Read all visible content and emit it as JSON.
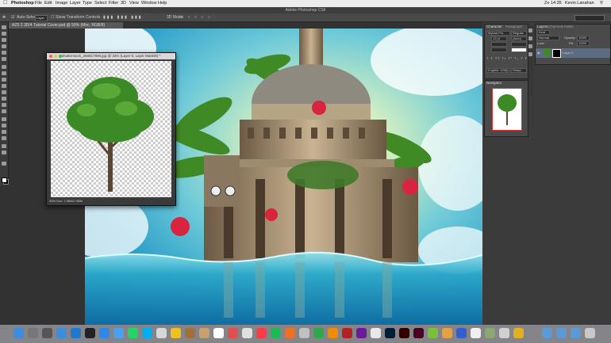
{
  "menubar": {
    "items": [
      "Photoshop",
      "File",
      "Edit",
      "Image",
      "Layer",
      "Type",
      "Select",
      "Filter",
      "3D",
      "View",
      "Window",
      "Help"
    ],
    "clock": "Zo 14:35",
    "user": "Kevin Lanahan"
  },
  "app_title": "Adobe Photoshop CS6",
  "options": {
    "auto_select": "Auto-Select:",
    "auto_select_value": "Layer",
    "transform": "Show Transform Controls",
    "mode": "3D Mode:"
  },
  "document_tab": "A2S 2 3D/4 Tutorial Cover.psd @ 50% (Mirc, RGB/8)",
  "float_window": {
    "title": "shutterstock_250817990.jpg @ 33% (Layer 0, Layer Mask/8) *",
    "status": "33%     Doc: 7.08M/7.08M"
  },
  "panels": {
    "properties_tab": "Character",
    "paragraph_tab": "Paragraph",
    "layers_tabs": [
      "Layers",
      "Channels",
      "Paths"
    ],
    "kind": "Kind",
    "blend": "Normal",
    "opacity_label": "Opacity:",
    "opacity": "100%",
    "fill_label": "Fill:",
    "fill": "100%",
    "lock_label": "Lock:",
    "layer_name": "Layer 0",
    "navigator_tab": "Navigator",
    "char_font": "Myriad Pro",
    "char_style": "Regular",
    "char_size": "12 pt",
    "char_lead": "(Auto)",
    "english": "English: USA",
    "sharp": "Sharp"
  },
  "colors": {
    "accent": "#2d9fc9",
    "sky_light": "#fdfbd0",
    "water": "#1f8fb5"
  }
}
